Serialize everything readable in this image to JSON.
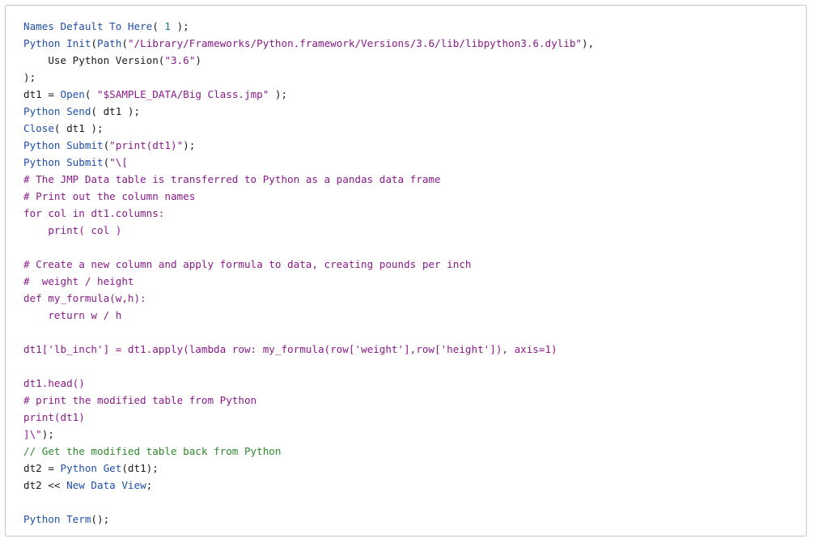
{
  "code_block": {
    "language": "JSL",
    "lines": [
      [
        {
          "t": "k",
          "v": "Names Default To Here"
        },
        {
          "t": "p",
          "v": "( "
        },
        {
          "t": "n",
          "v": "1"
        },
        {
          "t": "p",
          "v": " );"
        }
      ],
      [
        {
          "t": "k",
          "v": "Python Init"
        },
        {
          "t": "p",
          "v": "("
        },
        {
          "t": "k",
          "v": "Path"
        },
        {
          "t": "p",
          "v": "("
        },
        {
          "t": "s",
          "v": "\"/Library/Frameworks/Python.framework/Versions/3.6/lib/libpython3.6.dylib\""
        },
        {
          "t": "p",
          "v": "),"
        }
      ],
      [
        {
          "t": "p",
          "v": "    Use Python Version("
        },
        {
          "t": "s",
          "v": "\"3.6\""
        },
        {
          "t": "p",
          "v": ")"
        }
      ],
      [
        {
          "t": "p",
          "v": ");"
        }
      ],
      [
        {
          "t": "p",
          "v": "dt1 = "
        },
        {
          "t": "k",
          "v": "Open"
        },
        {
          "t": "p",
          "v": "( "
        },
        {
          "t": "s",
          "v": "\"$SAMPLE_DATA/Big Class.jmp\""
        },
        {
          "t": "p",
          "v": " );"
        }
      ],
      [
        {
          "t": "k",
          "v": "Python Send"
        },
        {
          "t": "p",
          "v": "( dt1 );"
        }
      ],
      [
        {
          "t": "k",
          "v": "Close"
        },
        {
          "t": "p",
          "v": "( dt1 );"
        }
      ],
      [
        {
          "t": "k",
          "v": "Python Submit"
        },
        {
          "t": "p",
          "v": "("
        },
        {
          "t": "s",
          "v": "\"print(dt1)\""
        },
        {
          "t": "p",
          "v": ");"
        }
      ],
      [
        {
          "t": "k",
          "v": "Python Submit"
        },
        {
          "t": "p",
          "v": "("
        },
        {
          "t": "s",
          "v": "\"\\["
        }
      ],
      [
        {
          "t": "s",
          "v": "# The JMP Data table is transferred to Python as a pandas data frame"
        }
      ],
      [
        {
          "t": "s",
          "v": "# Print out the column names"
        }
      ],
      [
        {
          "t": "s",
          "v": "for col in dt1.columns:"
        }
      ],
      [
        {
          "t": "s",
          "v": "    print( col )"
        }
      ],
      [
        {
          "t": "s",
          "v": ""
        }
      ],
      [
        {
          "t": "s",
          "v": "# Create a new column and apply formula to data, creating pounds per inch"
        }
      ],
      [
        {
          "t": "s",
          "v": "#  weight / height"
        }
      ],
      [
        {
          "t": "s",
          "v": "def my_formula(w,h):"
        }
      ],
      [
        {
          "t": "s",
          "v": "    return w / h"
        }
      ],
      [
        {
          "t": "s",
          "v": ""
        }
      ],
      [
        {
          "t": "s",
          "v": "dt1['lb_inch'] = dt1.apply(lambda row: my_formula(row['weight'],row['height']), axis=1)"
        }
      ],
      [
        {
          "t": "s",
          "v": ""
        }
      ],
      [
        {
          "t": "s",
          "v": "dt1.head()"
        }
      ],
      [
        {
          "t": "s",
          "v": "# print the modified table from Python"
        }
      ],
      [
        {
          "t": "s",
          "v": "print(dt1)"
        }
      ],
      [
        {
          "t": "s",
          "v": "]\\\""
        },
        {
          "t": "p",
          "v": ");"
        }
      ],
      [
        {
          "t": "c",
          "v": "// Get the modified table back from Python"
        }
      ],
      [
        {
          "t": "p",
          "v": "dt2 = "
        },
        {
          "t": "k",
          "v": "Python Get"
        },
        {
          "t": "p",
          "v": "(dt1);"
        }
      ],
      [
        {
          "t": "p",
          "v": "dt2 << "
        },
        {
          "t": "k",
          "v": "New Data View"
        },
        {
          "t": "p",
          "v": ";"
        }
      ],
      [
        {
          "t": "p",
          "v": ""
        }
      ],
      [
        {
          "t": "k",
          "v": "Python Term"
        },
        {
          "t": "p",
          "v": "();"
        }
      ]
    ]
  },
  "colors": {
    "keyword": "#1f4fa8",
    "string": "#8a1a8a",
    "number": "#0c7a7a",
    "comment": "#2c8a2c",
    "plain": "#1a1a1a",
    "border": "#c8c8c8"
  }
}
